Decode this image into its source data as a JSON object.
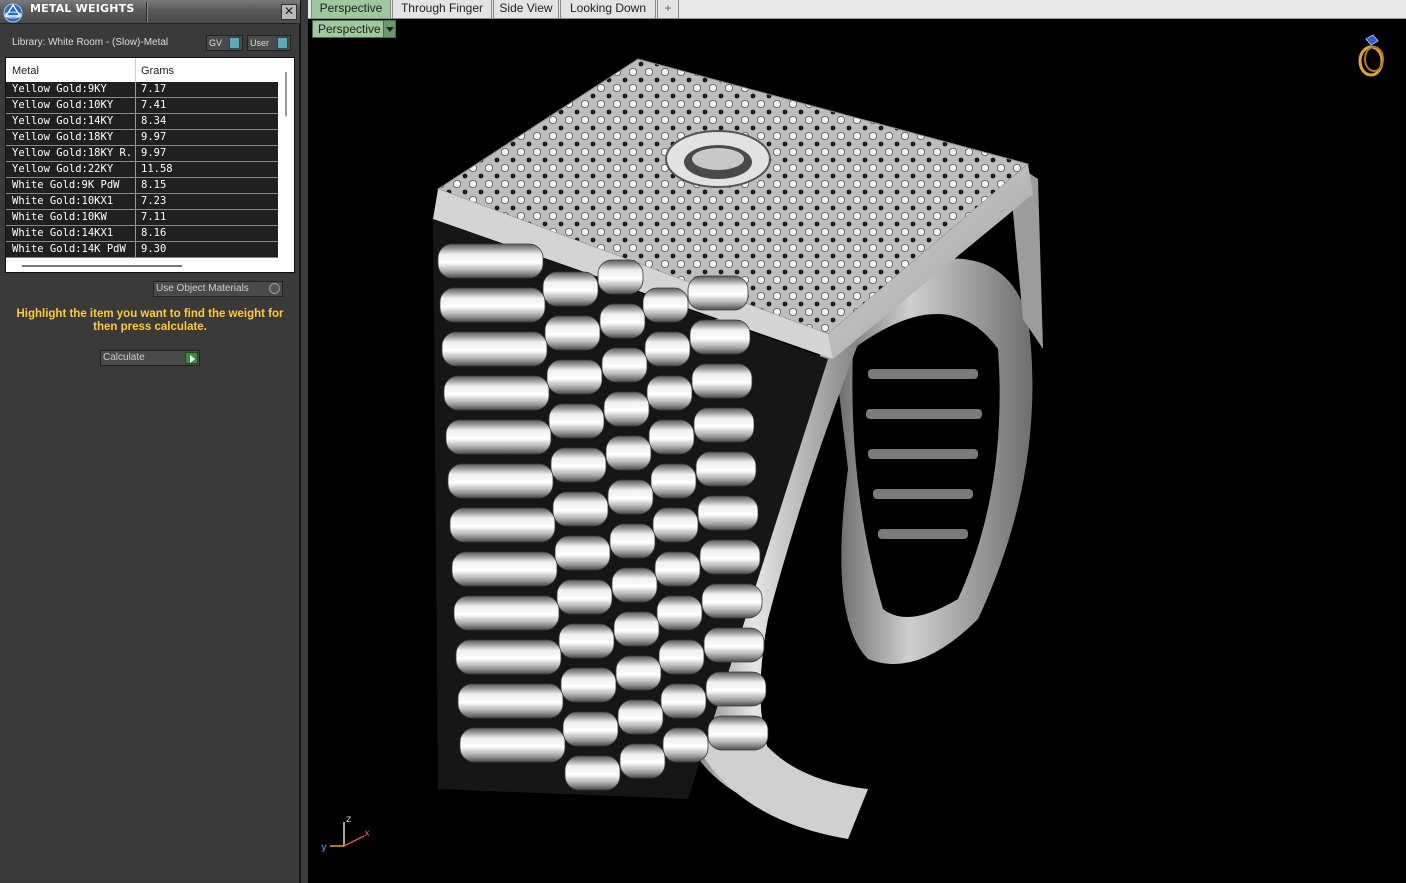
{
  "panel": {
    "title": "METAL WEIGHTS",
    "close_label": "✕",
    "library_label": "Library: White Room - (Slow)-Metal",
    "gv_label": "GV",
    "user_label": "User",
    "columns": {
      "metal": "Metal",
      "grams": "Grams"
    },
    "rows": [
      {
        "metal": "Yellow Gold:9KY",
        "grams": "7.17"
      },
      {
        "metal": "Yellow Gold:10KY",
        "grams": "7.41"
      },
      {
        "metal": "Yellow Gold:14KY",
        "grams": "8.34"
      },
      {
        "metal": "Yellow Gold:18KY",
        "grams": "9.97"
      },
      {
        "metal": "Yellow Gold:18KY R...",
        "grams": "9.97"
      },
      {
        "metal": "Yellow Gold:22KY",
        "grams": "11.58"
      },
      {
        "metal": "White Gold:9K PdW",
        "grams": "8.15"
      },
      {
        "metal": "White Gold:10KX1",
        "grams": "7.23"
      },
      {
        "metal": "White Gold:10KW",
        "grams": "7.11"
      },
      {
        "metal": "White Gold:14KX1",
        "grams": "8.16"
      },
      {
        "metal": "White Gold:14K PdW",
        "grams": "9.30"
      }
    ],
    "use_object_materials": "Use Object Materials",
    "hint": "Highlight the item you want to find the weight for then press calculate.",
    "calculate_label": "Calculate"
  },
  "tabs": [
    {
      "label": "Perspective",
      "active": true
    },
    {
      "label": "Through Finger",
      "active": false
    },
    {
      "label": "Side View",
      "active": false
    },
    {
      "label": "Looking Down",
      "active": false
    },
    {
      "label": "+",
      "active": false
    }
  ],
  "viewport": {
    "view_select": "Perspective",
    "axis": {
      "x": "x",
      "y": "y",
      "z": "z"
    },
    "colors": {
      "accent": "#9ec89e",
      "hint": "#ffcc33",
      "background": "#000000"
    },
    "icons": {
      "logo": "app-logo-icon",
      "corner": "ring-preview-icon"
    }
  }
}
